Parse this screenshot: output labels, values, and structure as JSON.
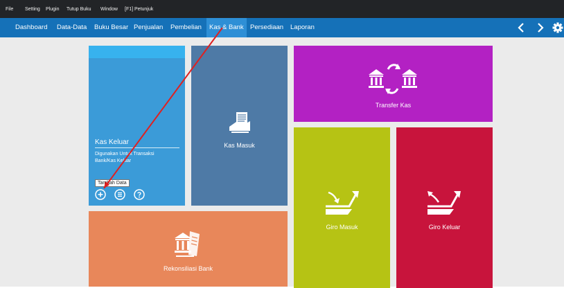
{
  "menubar": {
    "items": [
      "File",
      "Setting",
      "Plugin",
      "Tutup Buku",
      "Window",
      "[F1] Petunjuk"
    ]
  },
  "navbar": {
    "tabs": [
      "Dashboard",
      "Data-Data",
      "Buku Besar",
      "Penjualan",
      "Pembelian",
      "Kas & Bank",
      "Persediaan",
      "Laporan"
    ],
    "active_tab": "Kas & Bank",
    "back_icon": "chevron-left-icon",
    "forward_icon": "chevron-right-icon",
    "settings_icon": "gear-icon"
  },
  "tiles": {
    "kas_keluar": {
      "title": "Kas Keluar",
      "description": "Digunakan Untuk Transaksi Bank/Kas Keluar",
      "tooltip": "Tambah Data",
      "buttons": [
        "add-icon",
        "list-icon",
        "help-icon"
      ],
      "color": "#3b9bd8"
    },
    "kas_masuk": {
      "label": "Kas Masuk",
      "icon": "cash-receipt-icon",
      "color": "#4e7aa6"
    },
    "transfer_kas": {
      "label": "Transfer Kas",
      "icon": "bank-transfer-icon",
      "color": "#b321c3"
    },
    "giro_masuk": {
      "label": "Giro Masuk",
      "icon": "check-in-icon",
      "color": "#b6c314"
    },
    "giro_keluar": {
      "label": "Giro Keluar",
      "icon": "check-out-icon",
      "color": "#c8143c"
    },
    "rekonsiliasi_bank": {
      "label": "Rekonsiliasi Bank",
      "icon": "bank-reconcile-icon",
      "color": "#e8875a"
    }
  }
}
